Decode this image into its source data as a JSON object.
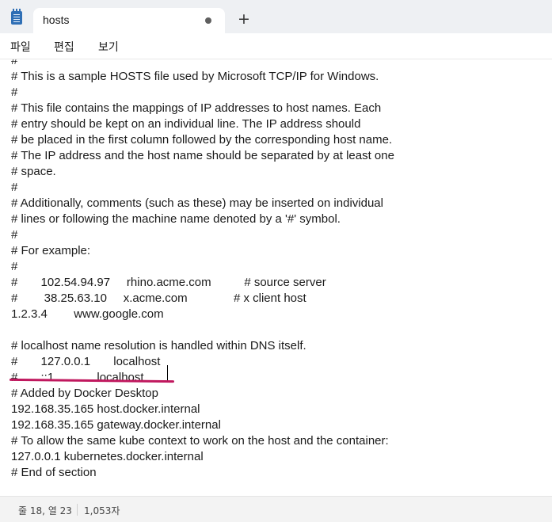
{
  "tab": {
    "title": "hosts",
    "unsaved_indicator": "●",
    "new_tab_symbol": "+"
  },
  "menu": {
    "items": [
      "파일",
      "편집",
      "보기"
    ]
  },
  "editor": {
    "lines": [
      "#",
      "# This is a sample HOSTS file used by Microsoft TCP/IP for Windows.",
      "#",
      "# This file contains the mappings of IP addresses to host names. Each",
      "# entry should be kept on an individual line. The IP address should",
      "# be placed in the first column followed by the corresponding host name.",
      "# The IP address and the host name should be separated by at least one",
      "# space.",
      "#",
      "# Additionally, comments (such as these) may be inserted on individual",
      "# lines or following the machine name denoted by a '#' symbol.",
      "#",
      "# For example:",
      "#",
      "#       102.54.94.97     rhino.acme.com          # source server",
      "#        38.25.63.10     x.acme.com              # x client host",
      "1.2.3.4        www.google.com",
      "",
      "# localhost name resolution is handled within DNS itself.",
      "#       127.0.0.1       localhost",
      "#       ::1             localhost",
      "# Added by Docker Desktop",
      "192.168.35.165 host.docker.internal",
      "192.168.35.165 gateway.docker.internal",
      "# To allow the same kube context to work on the host and the container:",
      "127.0.0.1 kubernetes.docker.internal",
      "# End of section"
    ]
  },
  "status": {
    "position": "줄 18, 열 23",
    "char_count": "1,053자"
  },
  "colors": {
    "annotation_underline": "#c0185e"
  }
}
